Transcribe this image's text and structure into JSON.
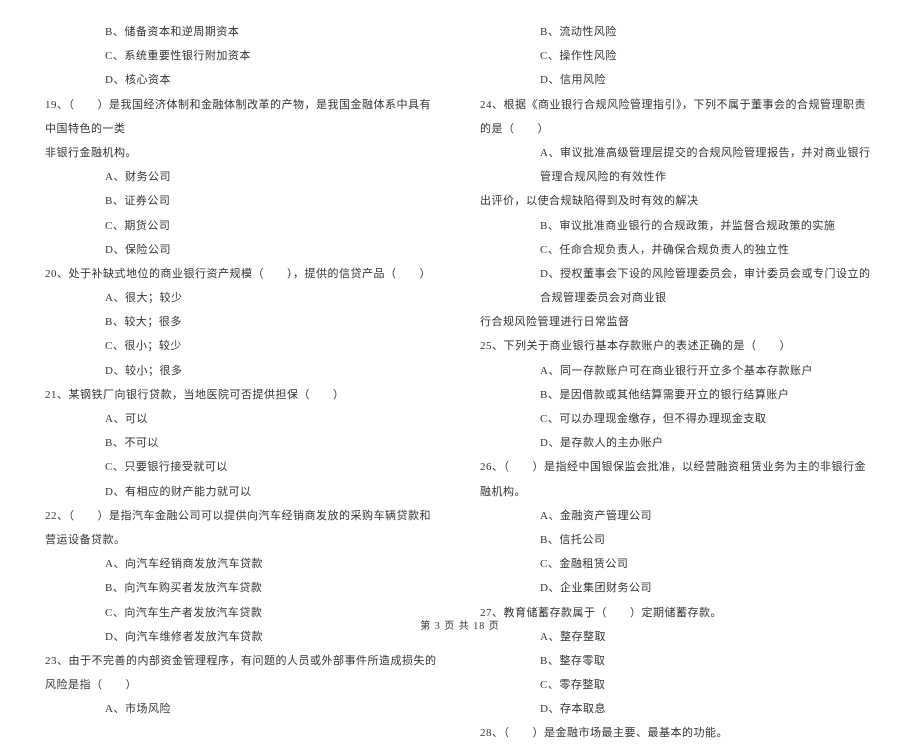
{
  "left_column": {
    "q18_options": [
      "B、储备资本和逆周期资本",
      "C、系统重要性银行附加资本",
      "D、核心资本"
    ],
    "q19": {
      "stem1": "19、（　　）是我国经济体制和金融体制改革的产物，是我国金融体系中具有中国特色的一类",
      "stem2": "非银行金融机构。",
      "options": [
        "A、财务公司",
        "B、证券公司",
        "C、期货公司",
        "D、保险公司"
      ]
    },
    "q20": {
      "stem": "20、处于补缺式地位的商业银行资产规模（　　），提供的信贷产品（　　）",
      "options": [
        "A、很大；较少",
        "B、较大；很多",
        "C、很小；较少",
        "D、较小；很多"
      ]
    },
    "q21": {
      "stem": "21、某钢铁厂向银行贷款，当地医院可否提供担保（　　）",
      "options": [
        "A、可以",
        "B、不可以",
        "C、只要银行接受就可以",
        "D、有相应的财产能力就可以"
      ]
    },
    "q22": {
      "stem": "22、（　　）是指汽车金融公司可以提供向汽车经销商发放的采购车辆贷款和营运设备贷款。",
      "options": [
        "A、向汽车经销商发放汽车贷款",
        "B、向汽车购买者发放汽车贷款",
        "C、向汽车生产者发放汽车贷款",
        "D、向汽车维修者发放汽车贷款"
      ]
    },
    "q23": {
      "stem": "23、由于不完善的内部资金管理程序，有问题的人员或外部事件所造成损失的风险是指（　　）",
      "options": [
        "A、市场风险"
      ]
    }
  },
  "right_column": {
    "q23_options": [
      "B、流动性风险",
      "C、操作性风险",
      "D、信用风险"
    ],
    "q24": {
      "stem": "24、根据《商业银行合规风险管理指引》，下列不属于董事会的合规管理职责的是（　　）",
      "optA1": "A、审议批准高级管理层提交的合规风险管理报告，并对商业银行管理合规风险的有效性作",
      "optA2": "出评价，以使合规缺陷得到及时有效的解决",
      "optB": "B、审议批准商业银行的合规政策，并监督合规政策的实施",
      "optC": "C、任命合规负责人，并确保合规负责人的独立性",
      "optD1": "D、授权董事会下设的风险管理委员会，审计委员会或专门设立的合规管理委员会对商业银",
      "optD2": "行合规风险管理进行日常监督"
    },
    "q25": {
      "stem": "25、下列关于商业银行基本存款账户的表述正确的是（　　）",
      "options": [
        "A、同一存款账户可在商业银行开立多个基本存款账户",
        "B、是因借款或其他结算需要开立的银行结算账户",
        "C、可以办理现金缴存，但不得办理现金支取",
        "D、是存款人的主办账户"
      ]
    },
    "q26": {
      "stem": "26、（　　）是指经中国银保监会批准，以经营融资租赁业务为主的非银行金融机构。",
      "options": [
        "A、金融资产管理公司",
        "B、信托公司",
        "C、金融租赁公司",
        "D、企业集团财务公司"
      ]
    },
    "q27": {
      "stem": "27、教育储蓄存款属于（　　）定期储蓄存款。",
      "options": [
        "A、整存整取",
        "B、整存零取",
        "C、零存整取",
        "D、存本取息"
      ]
    },
    "q28": {
      "stem": "28、（　　）是金融市场最主要、最基本的功能。"
    }
  },
  "footer": "第 3 页 共 18 页"
}
